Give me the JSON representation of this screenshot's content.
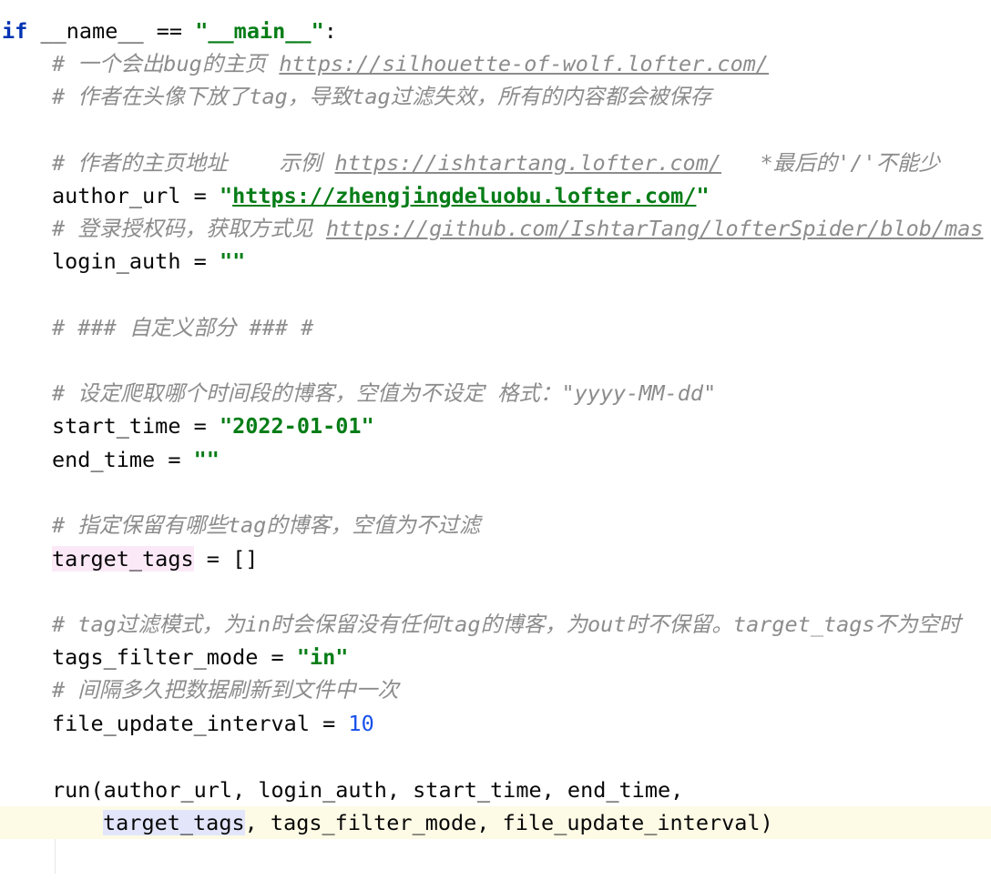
{
  "code": {
    "l1": {
      "kw": "if",
      "name": "__name__",
      "eq": " == ",
      "q1": "\"",
      "main": "__main__",
      "q2": "\"",
      "colon": ":"
    },
    "l2": {
      "comment": "# 一个会出bug的主页 ",
      "link": "https://silhouette-of-wolf.lofter.com/"
    },
    "l3": {
      "comment": "# 作者在头像下放了tag，导致tag过滤失效，所有的内容都会被保存"
    },
    "l5": {
      "comment": "# 作者的主页地址    示例 ",
      "link": "https://ishtartang.lofter.com/",
      "tail": "   *最后的'/'不能少"
    },
    "l6": {
      "var": "author_url",
      "assign": " = ",
      "q1": "\"",
      "link": "https://zhengjingdeluobu.lofter.com/",
      "q2": "\""
    },
    "l7": {
      "comment": "# 登录授权码，获取方式见 ",
      "link": "https://github.com/IshtarTang/lofterSpider/blob/mas"
    },
    "l8": {
      "var": "login_auth",
      "assign": " = ",
      "value": "\"\""
    },
    "l10": {
      "comment": "# ### 自定义部分 ### #"
    },
    "l12": {
      "comment": "# 设定爬取哪个时间段的博客，空值为不设定 格式：\"yyyy-MM-dd\""
    },
    "l13": {
      "var": "start_time",
      "assign": " = ",
      "value": "\"2022-01-01\""
    },
    "l14": {
      "var": "end_time",
      "assign": " = ",
      "value": "\"\""
    },
    "l16": {
      "comment": "# 指定保留有哪些tag的博客，空值为不过滤"
    },
    "l17": {
      "var": "target_tags",
      "assign": " = ",
      "value": "[]"
    },
    "l19": {
      "comment": "# tag过滤模式，为in时会保留没有任何tag的博客，为out时不保留。target_tags不为空时"
    },
    "l20": {
      "var": "tags_filter_mode",
      "assign": " = ",
      "value": "\"in\""
    },
    "l21": {
      "comment": "# 间隔多久把数据刷新到文件中一次"
    },
    "l22": {
      "var": "file_update_interval",
      "assign": " = ",
      "value": "10"
    },
    "l24": {
      "text": "run(author_url, login_auth, start_time, end_time,"
    },
    "l25": {
      "hl": "target_tags",
      "rest": ", tags_filter_mode, file_update_interval)"
    }
  },
  "colors": {
    "keyword": "#0033b3",
    "string": "#067d17",
    "number": "#1750eb",
    "comment": "#8c8c8c",
    "current_line": "#fdfbe6",
    "highlight_pink": "#fbe9f8",
    "highlight_blue": "#e3e6fb"
  }
}
